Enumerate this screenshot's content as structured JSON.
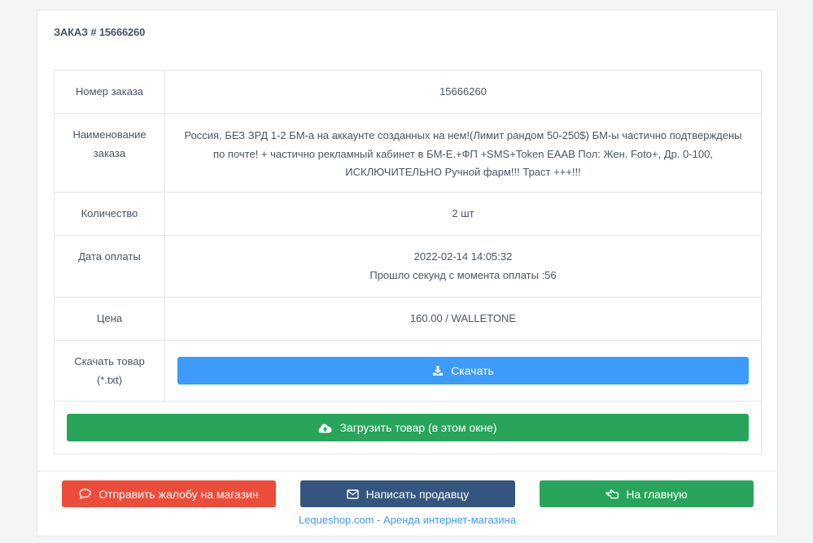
{
  "order": {
    "title": "ЗАКАЗ # 15666260",
    "rows": {
      "number": {
        "label": "Номер заказа",
        "value": "15666260"
      },
      "name": {
        "label_line1": "Наименование",
        "label_line2": "заказа",
        "line1": "Россия, БЕЗ ЗРД 1-2 БМ-а на аккаунте созданных на нем!(Лимит рандом 50-250$) БМ-ы частично подтверждены",
        "line2": "по почте! + частично рекламный кабинет в БМ-Е.+ФП +SMS+Token EAAB Пол: Жен. Foto+, Др. 0-100,",
        "line3": "ИСКЛЮЧИТЕЛЬНО Ручной фарм!!! Траст +++!!!"
      },
      "quantity": {
        "label": "Количество",
        "value": "2 шт"
      },
      "payment_date": {
        "label": "Дата оплаты",
        "value": "2022-02-14 14:05:32",
        "elapsed": "Прошло секунд с момента оплаты :56"
      },
      "price": {
        "label": "Цена",
        "value": "160.00 / WALLETONE"
      },
      "download": {
        "label_line1": "Скачать товар",
        "label_line2": "(*.txt)",
        "button": "Скачать"
      }
    },
    "upload_button": "Загрузить товар (в этом окне)"
  },
  "footer": {
    "complaint_button": "Отправить жалобу на магазин",
    "message_button": "Написать продавцу",
    "home_button": "На главную",
    "link": "Lequeshop.com - Аренда интернет-магазина"
  },
  "colors": {
    "blue": "#3c9bfb",
    "green": "#28a55a",
    "red": "#ec4d3b",
    "navy": "#34567e"
  },
  "icons": {
    "download": "download-icon",
    "upload": "cloud-upload-icon",
    "complaint": "comment-icon",
    "message": "envelope-icon",
    "home": "hand-point-left-icon"
  }
}
